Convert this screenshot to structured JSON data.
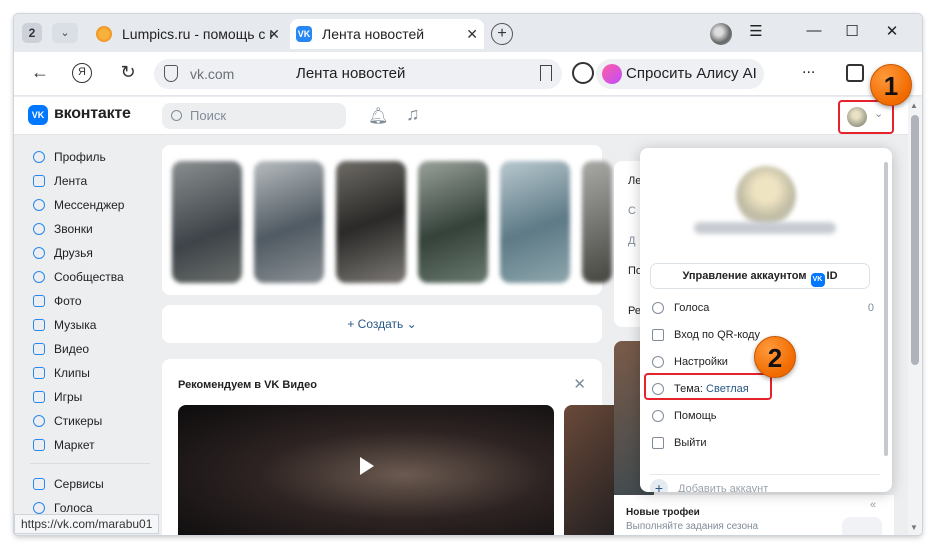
{
  "browser": {
    "tab_count": "2",
    "tabs": [
      {
        "title": "Lumpics.ru - помощь с ком"
      },
      {
        "title": "Лента новостей",
        "favicon": "VK"
      }
    ],
    "address": {
      "host": "vk.com",
      "page_title": "Лента новостей"
    },
    "alice_label": "Спросить Алису AI",
    "more_label": "...",
    "status_url": "https://vk.com/marabu01"
  },
  "vk": {
    "logo_text": "вконтакте",
    "logo_mark": "VK",
    "search_placeholder": "Поиск",
    "menu": [
      {
        "label": "Профиль",
        "icon": "user-circle-icon"
      },
      {
        "label": "Лента",
        "icon": "feed-icon"
      },
      {
        "label": "Мессенджер",
        "icon": "chat-icon"
      },
      {
        "label": "Звонки",
        "icon": "phone-icon"
      },
      {
        "label": "Друзья",
        "icon": "friends-icon"
      },
      {
        "label": "Сообщества",
        "icon": "groups-icon"
      },
      {
        "label": "Фото",
        "icon": "photo-icon"
      },
      {
        "label": "Музыка",
        "icon": "music-icon"
      },
      {
        "label": "Видео",
        "icon": "video-icon"
      },
      {
        "label": "Клипы",
        "icon": "clips-icon"
      },
      {
        "label": "Игры",
        "icon": "games-icon"
      },
      {
        "label": "Стикеры",
        "icon": "stickers-icon"
      },
      {
        "label": "Маркет",
        "icon": "market-icon"
      }
    ],
    "menu_bottom": [
      {
        "label": "Сервисы",
        "icon": "services-icon"
      },
      {
        "label": "Голоса",
        "icon": "votes-icon"
      }
    ],
    "create_label": "+ Создать ⌄",
    "recommend_title": "Рекомендуем в VK Видео",
    "right_labels": [
      "Ле",
      "С",
      "Д",
      "По",
      "Ре"
    ],
    "trophy_title": "Новые трофеи",
    "trophy_sub": "Выполняйте задания сезона"
  },
  "dropdown": {
    "manage_label": "Управление аккаунтом",
    "manage_id": "ID",
    "items": [
      {
        "label": "Голоса",
        "value": "0",
        "icon": "coins-icon"
      },
      {
        "label": "Вход по QR-коду",
        "value": "",
        "icon": "qr-icon"
      },
      {
        "label": "Настройки",
        "value": "",
        "icon": "settings-icon"
      },
      {
        "label": "Тема:",
        "value": "",
        "theme": "Светлая",
        "icon": "palette-icon"
      },
      {
        "label": "Помощь",
        "value": "",
        "icon": "help-icon"
      },
      {
        "label": "Выйти",
        "value": "",
        "icon": "logout-icon"
      }
    ],
    "add_account": "Добавить аккаунт"
  },
  "annotations": {
    "badge1": "1",
    "badge2": "2"
  },
  "colors": {
    "vk_blue": "#0077ff",
    "highlight_red": "#e6232b",
    "badge_orange": "#f16a00"
  }
}
